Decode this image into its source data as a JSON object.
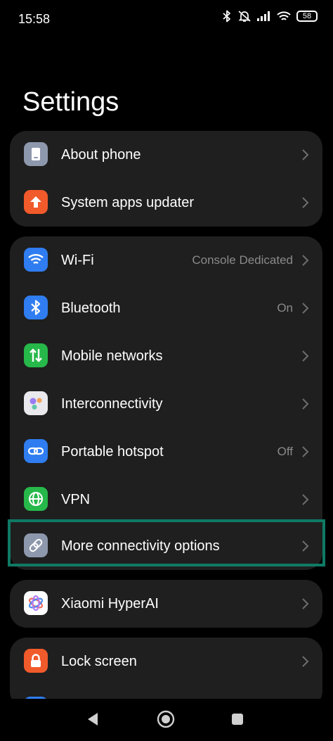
{
  "status_bar": {
    "time": "15:58",
    "battery": "58",
    "icons": [
      "bluetooth-icon",
      "silent-icon",
      "signal-icon",
      "wifi-icon",
      "battery-icon"
    ]
  },
  "page": {
    "title": "Settings"
  },
  "groups": [
    {
      "items": [
        {
          "label": "About phone",
          "value": "",
          "icon": "phone-icon",
          "icon_color": "#8e98ad"
        },
        {
          "label": "System apps updater",
          "value": "",
          "icon": "arrow-up-icon",
          "icon_color": "#f15a2b"
        }
      ]
    },
    {
      "items": [
        {
          "label": "Wi-Fi",
          "value": "Console Dedicated",
          "icon": "wifi-icon",
          "icon_color": "#2f7df0"
        },
        {
          "label": "Bluetooth",
          "value": "On",
          "icon": "bluetooth-icon",
          "icon_color": "#2f7df0"
        },
        {
          "label": "Mobile networks",
          "value": "",
          "icon": "mobile-data-icon",
          "icon_color": "#27b84a"
        },
        {
          "label": "Interconnectivity",
          "value": "",
          "icon": "interconnect-icon",
          "icon_color": "#e9e9ee"
        },
        {
          "label": "Portable hotspot",
          "value": "Off",
          "icon": "hotspot-icon",
          "icon_color": "#2f7df0"
        },
        {
          "label": "VPN",
          "value": "",
          "icon": "globe-icon",
          "icon_color": "#27b84a"
        },
        {
          "label": "More connectivity options",
          "value": "",
          "icon": "link-icon",
          "icon_color": "#8e98ad"
        }
      ]
    },
    {
      "items": [
        {
          "label": "Xiaomi HyperAI",
          "value": "",
          "icon": "hyperai-icon",
          "icon_color": "#ffffff"
        }
      ]
    },
    {
      "items": [
        {
          "label": "Lock screen",
          "value": "",
          "icon": "lock-icon",
          "icon_color": "#f15a2b"
        }
      ]
    }
  ],
  "colors": {
    "highlight": "#0f7a66",
    "card": "#1f1f1f",
    "value_text": "#8a8a8a"
  }
}
